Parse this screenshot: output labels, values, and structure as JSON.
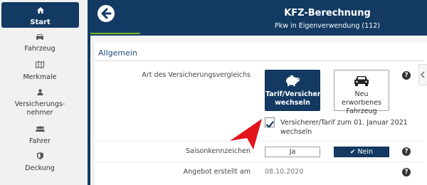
{
  "sidebar": {
    "items": [
      {
        "label": "Start",
        "icon": "home-icon"
      },
      {
        "label": "Fahrzeug",
        "icon": "car-icon"
      },
      {
        "label": "Merkmale",
        "icon": "map-icon"
      },
      {
        "label": "Versicherungs-nehmer",
        "icon": "user-icon"
      },
      {
        "label": "Fahrer",
        "icon": "users-icon"
      },
      {
        "label": "Deckung",
        "icon": "shield-icon"
      }
    ]
  },
  "header": {
    "title": "KFZ-Berechnung",
    "subtitle": "Pkw in Eigenverwendung (112)"
  },
  "section": {
    "title": "Allgemein"
  },
  "form": {
    "vergleich_label": "Art des Versicherungsvergleichs",
    "card_selected_label": "Tarif/Versicherer wechseln",
    "card_other_label": "Neu erworbenes Fahrzeug",
    "checkbox_label": "Versicherer/Tarif zum 01. Januar 2021 wechseln",
    "checkbox_checked": true,
    "saison_label": "Saisonkennzeichen",
    "ja_label": "Ja",
    "nein_label": "Nein",
    "angebot_label": "Angebot erstellt am",
    "angebot_value": "08.10.2020"
  },
  "colors": {
    "primary": "#133a63",
    "accent": "#76b82a",
    "arrow": "#e2141c"
  }
}
